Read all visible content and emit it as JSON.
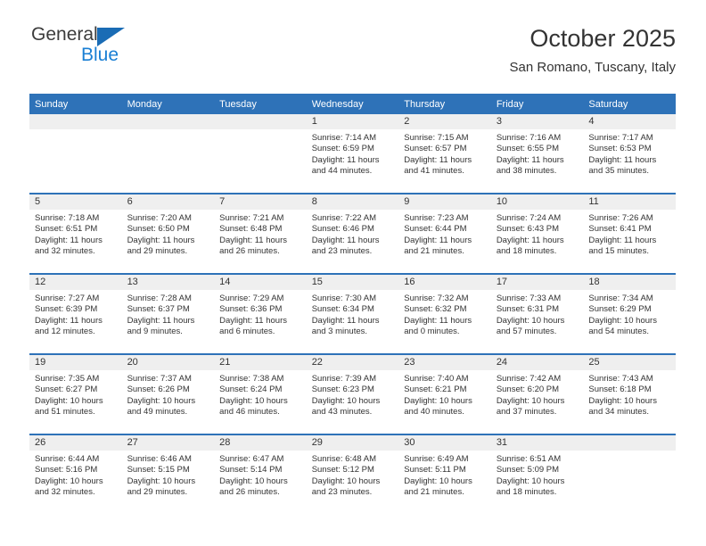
{
  "brand": {
    "name_top": "General",
    "name_bottom": "Blue",
    "triangle_icon": "triangle-icon",
    "accent_color": "#1a7fd4"
  },
  "header": {
    "title": "October 2025",
    "subtitle": "San Romano, Tuscany, Italy"
  },
  "theme": {
    "header_blue": "#2e72b8",
    "band_gray": "#efefef",
    "text": "#333333"
  },
  "weekday_headers": [
    "Sunday",
    "Monday",
    "Tuesday",
    "Wednesday",
    "Thursday",
    "Friday",
    "Saturday"
  ],
  "weeks": [
    [
      {
        "day": "",
        "sunrise": "",
        "sunset": "",
        "daylight_1": "",
        "daylight_2": ""
      },
      {
        "day": "",
        "sunrise": "",
        "sunset": "",
        "daylight_1": "",
        "daylight_2": ""
      },
      {
        "day": "",
        "sunrise": "",
        "sunset": "",
        "daylight_1": "",
        "daylight_2": ""
      },
      {
        "day": "1",
        "sunrise": "Sunrise: 7:14 AM",
        "sunset": "Sunset: 6:59 PM",
        "daylight_1": "Daylight: 11 hours",
        "daylight_2": "and 44 minutes."
      },
      {
        "day": "2",
        "sunrise": "Sunrise: 7:15 AM",
        "sunset": "Sunset: 6:57 PM",
        "daylight_1": "Daylight: 11 hours",
        "daylight_2": "and 41 minutes."
      },
      {
        "day": "3",
        "sunrise": "Sunrise: 7:16 AM",
        "sunset": "Sunset: 6:55 PM",
        "daylight_1": "Daylight: 11 hours",
        "daylight_2": "and 38 minutes."
      },
      {
        "day": "4",
        "sunrise": "Sunrise: 7:17 AM",
        "sunset": "Sunset: 6:53 PM",
        "daylight_1": "Daylight: 11 hours",
        "daylight_2": "and 35 minutes."
      }
    ],
    [
      {
        "day": "5",
        "sunrise": "Sunrise: 7:18 AM",
        "sunset": "Sunset: 6:51 PM",
        "daylight_1": "Daylight: 11 hours",
        "daylight_2": "and 32 minutes."
      },
      {
        "day": "6",
        "sunrise": "Sunrise: 7:20 AM",
        "sunset": "Sunset: 6:50 PM",
        "daylight_1": "Daylight: 11 hours",
        "daylight_2": "and 29 minutes."
      },
      {
        "day": "7",
        "sunrise": "Sunrise: 7:21 AM",
        "sunset": "Sunset: 6:48 PM",
        "daylight_1": "Daylight: 11 hours",
        "daylight_2": "and 26 minutes."
      },
      {
        "day": "8",
        "sunrise": "Sunrise: 7:22 AM",
        "sunset": "Sunset: 6:46 PM",
        "daylight_1": "Daylight: 11 hours",
        "daylight_2": "and 23 minutes."
      },
      {
        "day": "9",
        "sunrise": "Sunrise: 7:23 AM",
        "sunset": "Sunset: 6:44 PM",
        "daylight_1": "Daylight: 11 hours",
        "daylight_2": "and 21 minutes."
      },
      {
        "day": "10",
        "sunrise": "Sunrise: 7:24 AM",
        "sunset": "Sunset: 6:43 PM",
        "daylight_1": "Daylight: 11 hours",
        "daylight_2": "and 18 minutes."
      },
      {
        "day": "11",
        "sunrise": "Sunrise: 7:26 AM",
        "sunset": "Sunset: 6:41 PM",
        "daylight_1": "Daylight: 11 hours",
        "daylight_2": "and 15 minutes."
      }
    ],
    [
      {
        "day": "12",
        "sunrise": "Sunrise: 7:27 AM",
        "sunset": "Sunset: 6:39 PM",
        "daylight_1": "Daylight: 11 hours",
        "daylight_2": "and 12 minutes."
      },
      {
        "day": "13",
        "sunrise": "Sunrise: 7:28 AM",
        "sunset": "Sunset: 6:37 PM",
        "daylight_1": "Daylight: 11 hours",
        "daylight_2": "and 9 minutes."
      },
      {
        "day": "14",
        "sunrise": "Sunrise: 7:29 AM",
        "sunset": "Sunset: 6:36 PM",
        "daylight_1": "Daylight: 11 hours",
        "daylight_2": "and 6 minutes."
      },
      {
        "day": "15",
        "sunrise": "Sunrise: 7:30 AM",
        "sunset": "Sunset: 6:34 PM",
        "daylight_1": "Daylight: 11 hours",
        "daylight_2": "and 3 minutes."
      },
      {
        "day": "16",
        "sunrise": "Sunrise: 7:32 AM",
        "sunset": "Sunset: 6:32 PM",
        "daylight_1": "Daylight: 11 hours",
        "daylight_2": "and 0 minutes."
      },
      {
        "day": "17",
        "sunrise": "Sunrise: 7:33 AM",
        "sunset": "Sunset: 6:31 PM",
        "daylight_1": "Daylight: 10 hours",
        "daylight_2": "and 57 minutes."
      },
      {
        "day": "18",
        "sunrise": "Sunrise: 7:34 AM",
        "sunset": "Sunset: 6:29 PM",
        "daylight_1": "Daylight: 10 hours",
        "daylight_2": "and 54 minutes."
      }
    ],
    [
      {
        "day": "19",
        "sunrise": "Sunrise: 7:35 AM",
        "sunset": "Sunset: 6:27 PM",
        "daylight_1": "Daylight: 10 hours",
        "daylight_2": "and 51 minutes."
      },
      {
        "day": "20",
        "sunrise": "Sunrise: 7:37 AM",
        "sunset": "Sunset: 6:26 PM",
        "daylight_1": "Daylight: 10 hours",
        "daylight_2": "and 49 minutes."
      },
      {
        "day": "21",
        "sunrise": "Sunrise: 7:38 AM",
        "sunset": "Sunset: 6:24 PM",
        "daylight_1": "Daylight: 10 hours",
        "daylight_2": "and 46 minutes."
      },
      {
        "day": "22",
        "sunrise": "Sunrise: 7:39 AM",
        "sunset": "Sunset: 6:23 PM",
        "daylight_1": "Daylight: 10 hours",
        "daylight_2": "and 43 minutes."
      },
      {
        "day": "23",
        "sunrise": "Sunrise: 7:40 AM",
        "sunset": "Sunset: 6:21 PM",
        "daylight_1": "Daylight: 10 hours",
        "daylight_2": "and 40 minutes."
      },
      {
        "day": "24",
        "sunrise": "Sunrise: 7:42 AM",
        "sunset": "Sunset: 6:20 PM",
        "daylight_1": "Daylight: 10 hours",
        "daylight_2": "and 37 minutes."
      },
      {
        "day": "25",
        "sunrise": "Sunrise: 7:43 AM",
        "sunset": "Sunset: 6:18 PM",
        "daylight_1": "Daylight: 10 hours",
        "daylight_2": "and 34 minutes."
      }
    ],
    [
      {
        "day": "26",
        "sunrise": "Sunrise: 6:44 AM",
        "sunset": "Sunset: 5:16 PM",
        "daylight_1": "Daylight: 10 hours",
        "daylight_2": "and 32 minutes."
      },
      {
        "day": "27",
        "sunrise": "Sunrise: 6:46 AM",
        "sunset": "Sunset: 5:15 PM",
        "daylight_1": "Daylight: 10 hours",
        "daylight_2": "and 29 minutes."
      },
      {
        "day": "28",
        "sunrise": "Sunrise: 6:47 AM",
        "sunset": "Sunset: 5:14 PM",
        "daylight_1": "Daylight: 10 hours",
        "daylight_2": "and 26 minutes."
      },
      {
        "day": "29",
        "sunrise": "Sunrise: 6:48 AM",
        "sunset": "Sunset: 5:12 PM",
        "daylight_1": "Daylight: 10 hours",
        "daylight_2": "and 23 minutes."
      },
      {
        "day": "30",
        "sunrise": "Sunrise: 6:49 AM",
        "sunset": "Sunset: 5:11 PM",
        "daylight_1": "Daylight: 10 hours",
        "daylight_2": "and 21 minutes."
      },
      {
        "day": "31",
        "sunrise": "Sunrise: 6:51 AM",
        "sunset": "Sunset: 5:09 PM",
        "daylight_1": "Daylight: 10 hours",
        "daylight_2": "and 18 minutes."
      },
      {
        "day": "",
        "sunrise": "",
        "sunset": "",
        "daylight_1": "",
        "daylight_2": ""
      }
    ]
  ]
}
